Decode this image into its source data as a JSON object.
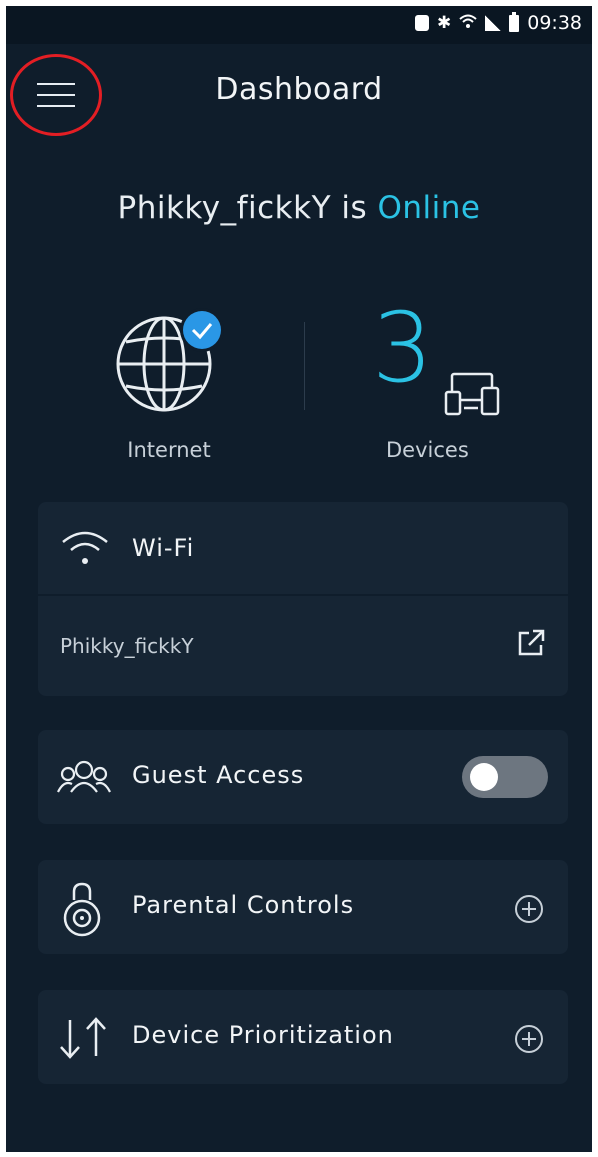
{
  "status_bar": {
    "time": "09:38",
    "icons": [
      "lock-icon",
      "bluetooth-icon",
      "wifi-signal-icon",
      "cell-signal-icon",
      "battery-icon"
    ]
  },
  "header": {
    "title": "Dashboard",
    "menu_icon": "hamburger-menu-icon"
  },
  "network_status": {
    "name": "Phikky_fickkY",
    "connector": "is",
    "state": "Online",
    "state_color": "#2bc2e4"
  },
  "internet": {
    "label": "Internet",
    "icon": "globe-icon",
    "status_icon": "check-badge-icon"
  },
  "devices": {
    "count": "3",
    "label": "Devices",
    "icon": "devices-icon"
  },
  "wifi": {
    "title": "Wi-Fi",
    "icon": "wifi-icon",
    "network_name": "Phikky_fickkY",
    "action_icon": "external-link-icon"
  },
  "rows": {
    "guest_access": {
      "label": "Guest Access",
      "icon": "guest-users-icon",
      "toggle_on": false
    },
    "parental_controls": {
      "label": "Parental Controls",
      "icon": "lock-shield-icon",
      "action_icon": "plus-circle-icon"
    },
    "device_prioritization": {
      "label": "Device Prioritization",
      "icon": "priority-arrows-icon",
      "action_icon": "plus-circle-icon"
    }
  },
  "colors": {
    "background": "#0f1d2b",
    "card": "#162534",
    "accent": "#2bc2e4",
    "highlight_circle": "#e31e24"
  }
}
